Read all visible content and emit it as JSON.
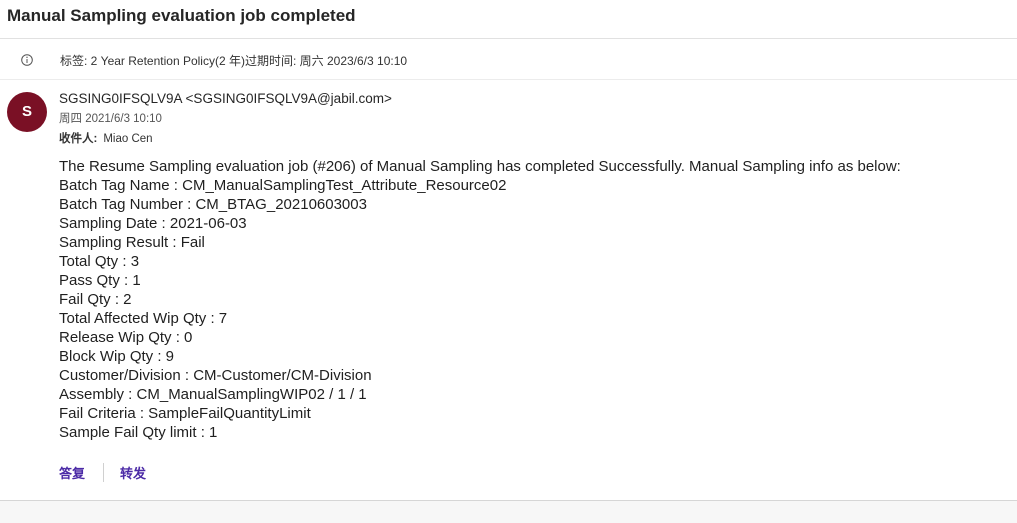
{
  "email": {
    "subject": "Manual Sampling evaluation job completed",
    "retention_notice": "标签: 2 Year Retention Policy(2 年)过期时间: 周六 2023/6/3 10:10",
    "avatar_initial": "S",
    "sender": "SGSING0IFSQLV9A <SGSING0IFSQLV9A@jabil.com>",
    "sent_date": "周四 2021/6/3 10:10",
    "recipient_label": "收件人:",
    "recipient_name": "Miao Cen",
    "body_lines": [
      "The Resume Sampling evaluation job (#206) of Manual Sampling has completed Successfully. Manual Sampling info as below:",
      "Batch Tag Name : CM_ManualSamplingTest_Attribute_Resource02",
      "Batch Tag Number : CM_BTAG_20210603003",
      "Sampling Date : 2021-06-03",
      "Sampling Result : Fail",
      "Total Qty : 3",
      "Pass Qty : 1",
      "Fail Qty : 2",
      "Total Affected Wip Qty : 7",
      "Release Wip Qty : 0",
      "Block Wip Qty : 9",
      "Customer/Division : CM-Customer/CM-Division",
      "Assembly : CM_ManualSamplingWIP02 / 1 / 1",
      "Fail Criteria : SampleFailQuantityLimit",
      "Sample Fail Qty limit : 1"
    ]
  },
  "actions": {
    "reply_label": "答复",
    "forward_label": "转发"
  },
  "colors": {
    "avatar_bg": "#7a1025",
    "action_link": "#4b2aa6"
  },
  "icons": {
    "retention": "info-icon"
  }
}
